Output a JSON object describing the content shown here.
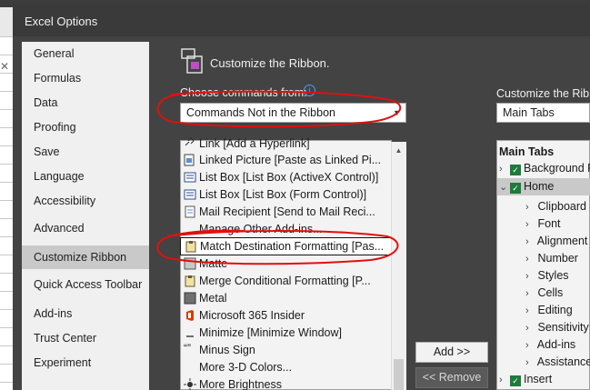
{
  "window": {
    "title": "Excel Options"
  },
  "nav": {
    "items": [
      {
        "label": "General"
      },
      {
        "label": "Formulas"
      },
      {
        "label": "Data"
      },
      {
        "label": "Proofing"
      },
      {
        "label": "Save"
      },
      {
        "label": "Language"
      },
      {
        "label": "Accessibility"
      },
      {
        "label": "Advanced"
      },
      {
        "label": "Customize Ribbon",
        "selected": true
      },
      {
        "label": "Quick Access Toolbar"
      },
      {
        "label": "Add-ins"
      },
      {
        "label": "Trust Center"
      },
      {
        "label": "Experiment"
      }
    ]
  },
  "header": {
    "title": "Customize the Ribbon.",
    "icon": "customize-ribbon-icon"
  },
  "choose": {
    "label": "Choose commands from:",
    "info_icon": "info-icon",
    "value": "Commands Not in the Ribbon"
  },
  "customize": {
    "label": "Customize the Ribb",
    "value": "Main Tabs"
  },
  "commands": [
    {
      "label": "Link [Add a Hyperlink]",
      "icon": "link-icon"
    },
    {
      "label": "Linked Picture [Paste as Linked Pi...",
      "icon": "linked-picture-icon"
    },
    {
      "label": "List Box [List Box (ActiveX Control)]",
      "icon": "list-box-icon"
    },
    {
      "label": "List Box [List Box (Form Control)]",
      "icon": "list-box-icon"
    },
    {
      "label": "Mail Recipient [Send to Mail Reci...",
      "icon": "mail-icon"
    },
    {
      "label": "Manage Other Add-ins...",
      "icon": ""
    },
    {
      "label": "Match Destination Formatting [Pas...",
      "icon": "clipboard-icon",
      "selected": true
    },
    {
      "label": "Matte",
      "icon": "matte-icon"
    },
    {
      "label": "Merge Conditional Formatting [P...",
      "icon": "clipboard-icon"
    },
    {
      "label": "Metal",
      "icon": "metal-icon"
    },
    {
      "label": "Microsoft 365 Insider",
      "icon": "office-icon"
    },
    {
      "label": "Minimize [Minimize Window]",
      "icon": "minimize-icon"
    },
    {
      "label": "Minus Sign",
      "icon": "quote-icon"
    },
    {
      "label": "More 3-D Colors...",
      "icon": ""
    },
    {
      "label": "More Brightness",
      "icon": "brightness-icon"
    }
  ],
  "buttons": {
    "add": "Add >>",
    "remove": "<< Remove"
  },
  "tree": {
    "header": "Main Tabs",
    "items": [
      {
        "label": "Background R",
        "level": 0,
        "expander": "›",
        "checked": true
      },
      {
        "label": "Home",
        "level": 0,
        "expander": "⌄",
        "checked": true,
        "selected": true
      },
      {
        "label": "Clipboard",
        "level": 1,
        "expander": "›"
      },
      {
        "label": "Font",
        "level": 1,
        "expander": "›"
      },
      {
        "label": "Alignment",
        "level": 1,
        "expander": "›"
      },
      {
        "label": "Number",
        "level": 1,
        "expander": "›"
      },
      {
        "label": "Styles",
        "level": 1,
        "expander": "›"
      },
      {
        "label": "Cells",
        "level": 1,
        "expander": "›"
      },
      {
        "label": "Editing",
        "level": 1,
        "expander": "›"
      },
      {
        "label": "Sensitivity",
        "level": 1,
        "expander": "›"
      },
      {
        "label": "Add-ins",
        "level": 1,
        "expander": "›"
      },
      {
        "label": "Assistance",
        "level": 1,
        "expander": "›"
      },
      {
        "label": "Insert",
        "level": 0,
        "expander": "›",
        "checked": true
      }
    ]
  },
  "colors": {
    "annotation": "#e01010",
    "check": "#1f7a3b"
  }
}
